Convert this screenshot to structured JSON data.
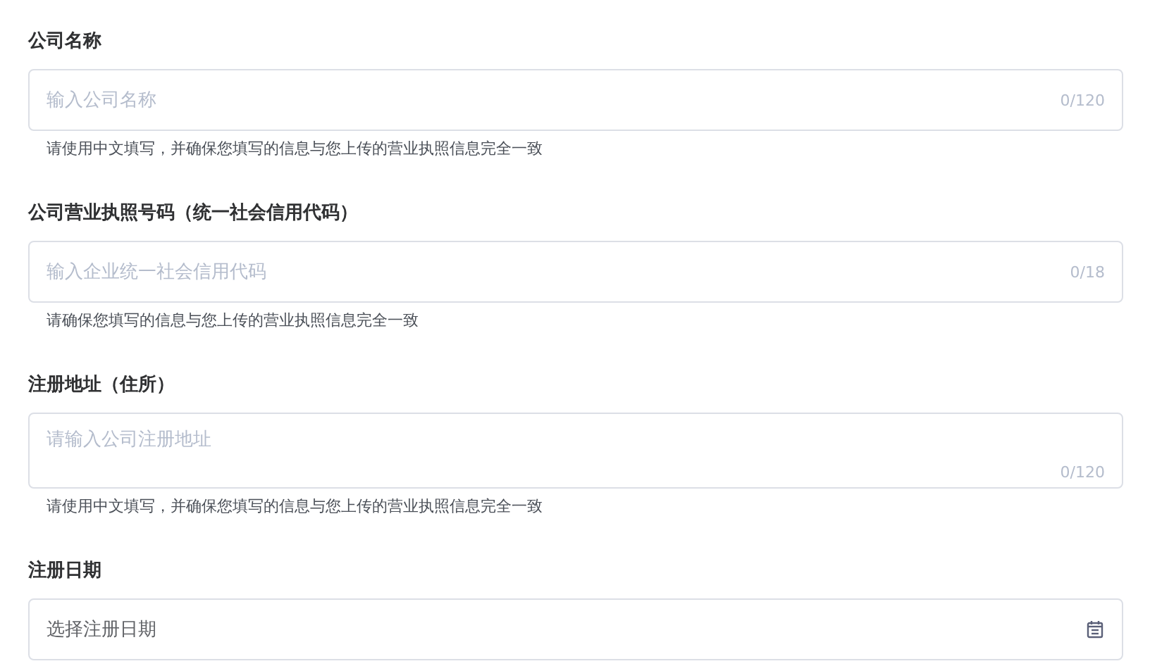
{
  "fields": [
    {
      "kind": "input",
      "label": "公司名称",
      "placeholder": "输入公司名称",
      "counter": "0/120",
      "hint": "请使用中文填写，并确保您填写的信息与您上传的营业执照信息完全一致"
    },
    {
      "kind": "input",
      "label": "公司营业执照号码（统一社会信用代码）",
      "placeholder": "输入企业统一社会信用代码",
      "counter": "0/18",
      "hint": "请确保您填写的信息与您上传的营业执照信息完全一致"
    },
    {
      "kind": "textarea",
      "label": "注册地址（住所）",
      "placeholder": "请输入公司注册地址",
      "counter": "0/120",
      "hint": "请使用中文填写，并确保您填写的信息与您上传的营业执照信息完全一致"
    },
    {
      "kind": "date",
      "label": "注册日期",
      "placeholder": "选择注册日期"
    }
  ]
}
